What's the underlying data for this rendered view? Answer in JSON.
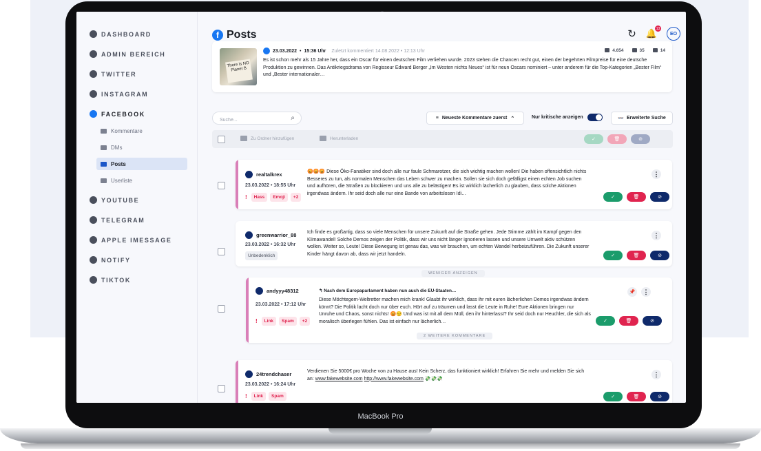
{
  "device": {
    "label": "MacBook Pro"
  },
  "sidebar": {
    "items": [
      {
        "label": "DASHBOARD",
        "icon": "home-icon"
      },
      {
        "label": "ADMIN BEREICH",
        "icon": "admin-icon"
      },
      {
        "label": "TWITTER",
        "icon": "twitter-icon"
      },
      {
        "label": "INSTAGRAM",
        "icon": "instagram-icon"
      },
      {
        "label": "FACEBOOK",
        "icon": "facebook-icon"
      },
      {
        "label": "YOUTUBE",
        "icon": "youtube-icon"
      },
      {
        "label": "TELEGRAM",
        "icon": "telegram-icon"
      },
      {
        "label": "APPLE IMESSAGE",
        "icon": "imessage-icon"
      },
      {
        "label": "NOTIFY",
        "icon": "notify-icon"
      },
      {
        "label": "TIKTOK",
        "icon": "tiktok-icon"
      }
    ],
    "facebook_sub": [
      {
        "label": "Kommentare"
      },
      {
        "label": "DMs"
      },
      {
        "label": "Posts"
      },
      {
        "label": "Userliste"
      }
    ]
  },
  "header": {
    "title": "Posts",
    "notification_count": "13",
    "avatar_initials": "EO",
    "refresh_glyph": "↻",
    "bell_glyph": "🔔"
  },
  "post": {
    "date": "23.03.2022",
    "time": "15:36 Uhr",
    "last_comment": "Zuletzt kommentiert 14.08.2022 • 12:13 Uhr",
    "stats": {
      "comments": "4.654",
      "shares": "35",
      "reactions": "14"
    },
    "thumb_text": "There is NO Planet B",
    "text": "Es ist schon mehr als 15 Jahre her, dass ein Oscar für einen deutschen Film verliehen wurde. 2023 stehen die Chancen recht gut, einen der begehrten Filmpreise für eine deutsche Produktion zu gewinnen. Das Antikriegsdrama von Regisseur Edward Berger „Im Westen nichts Neues“ ist für neun Oscars nominiert – unter anderem für die Top-Kategorien „Bester Film“ und „Bester internationaler…"
  },
  "toolbar": {
    "search_placeholder": "Suche...",
    "sort_label": "Neueste Kommentare zuerst",
    "critical_label": "Nur kritische anzeigen",
    "advanced_label": "Erweiterte Suche",
    "add_folder": "Zu Ordner hinzufügen",
    "download": "Herunterladen"
  },
  "comments": [
    {
      "user": "realtalkrex",
      "date": "23.03.2022 • 18:55 Uhr",
      "tags": [
        "Hass",
        "Emoji",
        "+2"
      ],
      "text": "😡😡😡 Diese Öko-Fanatiker sind doch alle nur faule Schmarotzer, die sich wichtig machen wollen! Die haben offensichtlich nichts Besseres zu tun, als normalen Menschen das Leben schwer zu machen. Sollen sie sich doch gefälligst einen echten Job suchen und aufhören, die Straßen zu blockieren und uns alle zu belästigen! Es ist wirklich lächerlich zu glauben, dass solche Aktionen irgendwas ändern. Ihr seid doch alle nur eine Bande von arbeitslosen Idi…"
    },
    {
      "user": "greenwarrior_88",
      "date": "23.03.2022 • 16:32 Uhr",
      "tags": [
        "Unbedenklich"
      ],
      "text": "Ich finde es großartig, dass so viele Menschen für unsere Zukunft auf die Straße gehen. Jede Stimme zählt im Kampf gegen den Klimawandel! Solche Demos zeigen der Politik, dass wir uns nicht länger ignorieren lassen und unsere Umwelt aktiv schützen wollen. Weiter so, Leute! Diese Bewegung ist genau das, was wir brauchen, um echten Wandel herbeizuführen. Die Zukunft unserer Kinder hängt davon ab, dass wir jetzt handeln.",
      "less_label": "WENIGER ANZEIGEN"
    },
    {
      "user": "andyyy48312",
      "date": "23.03.2022 • 17:12 Uhr",
      "reply_to": "Nach dem Europaparlament haben nun auch die EU-Staaten…",
      "tags": [
        "Link",
        "Spam",
        "+2"
      ],
      "text": "Diese Möchtegern-Weltretter machen mich krank! Glaubt ihr wirklich, dass ihr mit euren lächerlichen Demos irgendwas ändern könnt? Die Politik lacht doch nur über euch. Hört auf zu träumen und lasst die Leute in Ruhe! Eure Aktionen bringen nur Unruhe und Chaos, sonst nichts! 😡😒 Und was ist mit all dem Müll, den ihr hinterlasst? Ihr seid doch nur Heuchler, die sich als moralisch überlegen fühlen. Das ist einfach nur lächerlich…",
      "more_label": "2 WEITERE KOMMENTARE"
    },
    {
      "user": "24trendchaser",
      "date": "23.03.2022 • 16:24 Uhr",
      "tags": [
        "Link",
        "Spam"
      ],
      "text_before": "Verdienen Sie 5000€ pro Woche von zu Hause aus! Kein Scherz, das funktioniert wirklich! Erfahren Sie mehr und melden Sie sich an: ",
      "link1": "www.fakewebsite.com",
      "link2": "http://www.fakewebsite.com",
      "text_after": " 💸💸💸"
    }
  ],
  "colors": {
    "accent": "#1a56c8",
    "facebook": "#1877f2",
    "approve": "#1b9c6b",
    "delete": "#e0244f",
    "hide": "#0f2a6b",
    "flag_bar": "#d97fb8"
  }
}
